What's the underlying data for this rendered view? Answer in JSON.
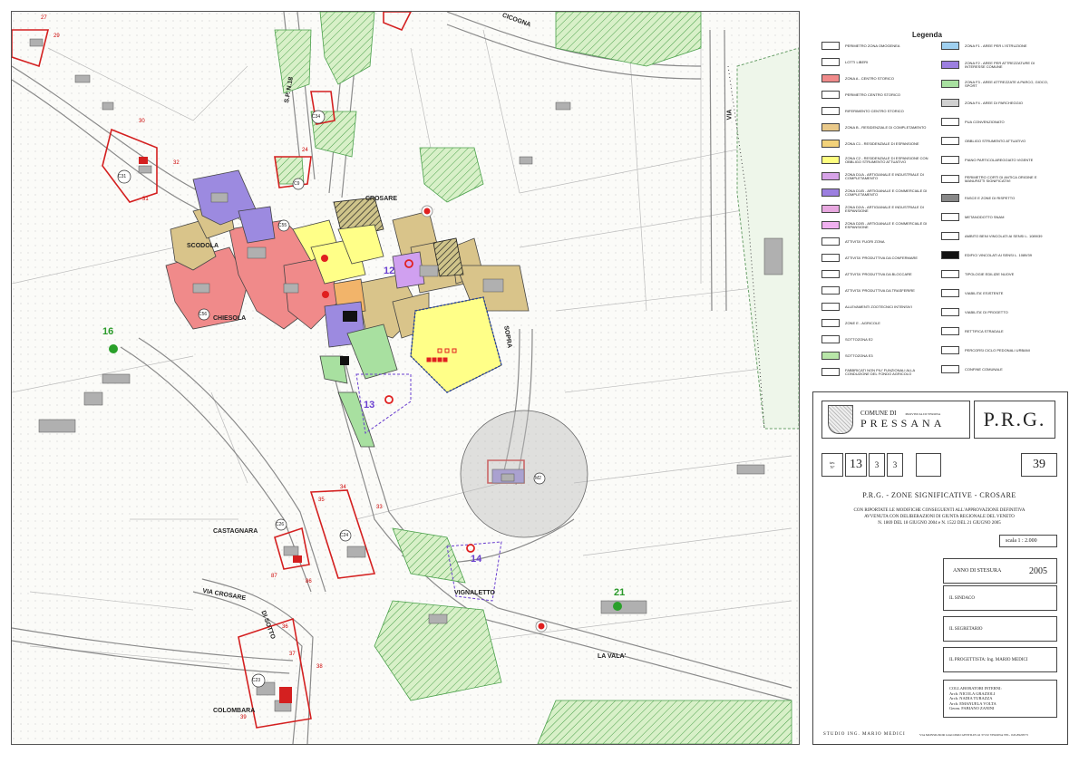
{
  "legend": {
    "title": "Legenda",
    "items": [
      {
        "label": "PERIMETRO ZONA OMOGENEA",
        "color": "#ffffff"
      },
      {
        "label": "LOTTI LIBERI",
        "color": "#ffffff"
      },
      {
        "label": "ZONA A - CENTRO STORICO",
        "color": "#f08a8a"
      },
      {
        "label": "PERIMETRO CENTRO STORICO",
        "color": "#ffffff"
      },
      {
        "label": "RIFERIMENTO CENTRO STORICO",
        "color": "#ffffff"
      },
      {
        "label": "ZONA B - RESIDENZIALE DI COMPLETAMENTO",
        "color": "#e9c98a"
      },
      {
        "label": "ZONA C1 - RESIDENZIALE DI ESPANSIONE",
        "color": "#f2d27a"
      },
      {
        "label": "ZONA C2 - RESIDENZIALE DI ESPANSIONE CON OBBLIGO STRUMENTO ATTUATIVO",
        "color": "#ffff80"
      },
      {
        "label": "ZONA D1/A - ARTIGIANALE E INDUSTRIALE DI COMPLETAMENTO",
        "color": "#d7a3e8"
      },
      {
        "label": "ZONA D1/B - ARTIGIANALE E COMMERCIALE DI COMPLETAMENTO",
        "color": "#9c7fe0"
      },
      {
        "label": "ZONA D2/A - ARTIGIANALE E INDUSTRIALE DI ESPANSIONE",
        "color": "#e8a8e0"
      },
      {
        "label": "ZONA D2/B - ARTIGIANALE E COMMERCIALE DI ESPANSIONE",
        "color": "#f0b0f0"
      },
      {
        "label": "ATTIVITA' FUORI ZONA",
        "color": "#ffffff"
      },
      {
        "label": "ATTIVITA' PRODUTTIVA DA CONFERMARE",
        "color": "#ffffff"
      },
      {
        "label": "ATTIVITA' PRODUTTIVA DA BLOCCARE",
        "color": "#ffffff"
      },
      {
        "label": "ATTIVITA' PRODUTTIVA DA TRASFERIRE",
        "color": "#ffffff"
      },
      {
        "label": "ALLEVAMENTI ZOOTECNICI INTENSIVI",
        "color": "#ffffff"
      },
      {
        "label": "ZONE E - AGRICOLE",
        "color": "#ffffff"
      },
      {
        "label": "SOTTOZONA E2",
        "color": "#ffffff"
      },
      {
        "label": "SOTTOZONA E3",
        "color": "#b8e6a8"
      },
      {
        "label": "FABBRICATI NON PIU' FUNZIONALI ALLA CONDUZIONE DEL FONDO AGRICOLO",
        "color": "#ffffff"
      },
      {
        "label": "ZONA F1 - AREE PER L'ISTRUZIONE",
        "color": "#9fd0f0"
      },
      {
        "label": "ZONA F2 - AREE PER ATTREZZATURE DI INTERESSE COMUNE",
        "color": "#9c7fe0"
      },
      {
        "label": "ZONA F3 - AREE ATTREZZATE A PARCO, GIOCO, SPORT",
        "color": "#a8e0a0"
      },
      {
        "label": "ZONA F4 - AREE DI PARCHEGGIO",
        "color": "#d0d0d0"
      },
      {
        "label": "PUA CONVENZIONATO",
        "color": "#ffffff"
      },
      {
        "label": "OBBLIGO STRUMENTO ATTUATIVO",
        "color": "#ffffff"
      },
      {
        "label": "PIANO PARTICOLAREGGIATO VIGENTE",
        "color": "#ffffff"
      },
      {
        "label": "PERIMETRO CORTI DI ANTICA ORIGINE E MANUFATTI SIGNIFICATIVI",
        "color": "#ffffff"
      },
      {
        "label": "FASCE E ZONE DI RISPETTO",
        "color": "#888888"
      },
      {
        "label": "METANODOTTO SNAM",
        "color": "#ffffff"
      },
      {
        "label": "AMBITO BENI VINCOLATI AI SENSI L. 1089/39",
        "color": "#ffffff"
      },
      {
        "label": "EDIFICI VINCOLATI AI SENSI L. 1089/39",
        "color": "#111111"
      },
      {
        "label": "TIPOLOGIE EDILIZIE NUOVE",
        "color": "#ffffff"
      },
      {
        "label": "VIABILITA' ESISTENTE",
        "color": "#ffffff"
      },
      {
        "label": "VIABILITA' DI PROGETTO",
        "color": "#ffffff"
      },
      {
        "label": "RETTIFICA STRADALE",
        "color": "#ffffff"
      },
      {
        "label": "PERCORSI CICLO PEDONALI URBANI",
        "color": "#ffffff"
      },
      {
        "label": "CONFINE COMUNALE",
        "color": "#ffffff"
      }
    ]
  },
  "title_block": {
    "comune_label": "COMUNE DI",
    "provincia": "PROVINCIA DI VERONA",
    "comune": "PRESSANA",
    "plan": "P.R.G.",
    "tav_label": "tav.",
    "n_label": "N°",
    "tav_number": "13",
    "tav_sub1": "3",
    "tav_sub2": "3",
    "sheet_number": "39",
    "heading": "P.R.G.  -  ZONE SIGNIFICATIVE - CROSARE",
    "note_1": "CON RIPORTATE LE MODIFICHE CONSEGUENTI ALL'APPROVAZIONE DEFINITIVA",
    "note_2": "AVVENUTA CON DELIBERAZIONI DI GIUNTA REGIONALE DEL VENETO",
    "note_3": "N. 1869 DEL 18 GIUGNO 2004 e N. 1522 DEL 21 GIUGNO 2005",
    "scale": "scala   1 : 2.000",
    "year_label": "ANNO DI STESURA",
    "year": "2005",
    "sindaco": "IL SINDACO",
    "segretario": "IL SEGRETARIO",
    "progettista": "IL PROGETTISTA:    Ing. MARIO MEDICI",
    "collaboratori_label": "COLLABORATORI INTERNI:",
    "collaboratori": [
      "Arch. NICOLA GRAZIOLI",
      "Arch. NADIA TURAZZA",
      "Arch. EMANUELA VOLTA",
      "Geom. FABIANO ZANINI"
    ],
    "studio": "STUDIO  ING. MARIO MEDICI",
    "studio_address": "VIA MONSIGNOR GIACOMO GENTILIN 42    37132 VERONA    TEL. 045-8920573"
  },
  "map": {
    "places": [
      {
        "id": "crosare",
        "label": "CROSARE"
      },
      {
        "id": "scodola",
        "label": "SCODOLA"
      },
      {
        "id": "chiesola",
        "label": "CHIESOLA"
      },
      {
        "id": "castagnara",
        "label": "CASTAGNARA"
      },
      {
        "id": "colombara",
        "label": "COLOMBARA"
      },
      {
        "id": "vignaletto",
        "label": "VIGNALETTO"
      },
      {
        "id": "lavala",
        "label": "LA VALA'"
      },
      {
        "id": "sopra",
        "label": "SOPRA"
      },
      {
        "id": "cicogna",
        "label": "CICOGNA"
      },
      {
        "id": "via",
        "label": "VIA"
      },
      {
        "id": "viacrosare",
        "label": "VIA    CROSARE"
      },
      {
        "id": "disotto",
        "label": "DI SOTTO"
      },
      {
        "id": "sp",
        "label": "S.P. N.18"
      }
    ],
    "zone_numbers": [
      {
        "id": "z12",
        "label": "12",
        "color": "#6a3fd0"
      },
      {
        "id": "z13",
        "label": "13",
        "color": "#6a3fd0"
      },
      {
        "id": "z14",
        "label": "14",
        "color": "#6a3fd0"
      },
      {
        "id": "z16",
        "label": "16",
        "color": "#2a9a2a"
      },
      {
        "id": "z21",
        "label": "21",
        "color": "#2a9a2a"
      }
    ],
    "red_numbers": [
      "27",
      "29",
      "30",
      "32",
      "31",
      "24",
      "35",
      "34",
      "33",
      "87",
      "86",
      "36",
      "37",
      "38",
      "39"
    ],
    "codes": [
      "C31",
      "C34",
      "C9",
      "C55",
      "C56",
      "C26",
      "C24",
      "C23",
      "M2"
    ]
  }
}
